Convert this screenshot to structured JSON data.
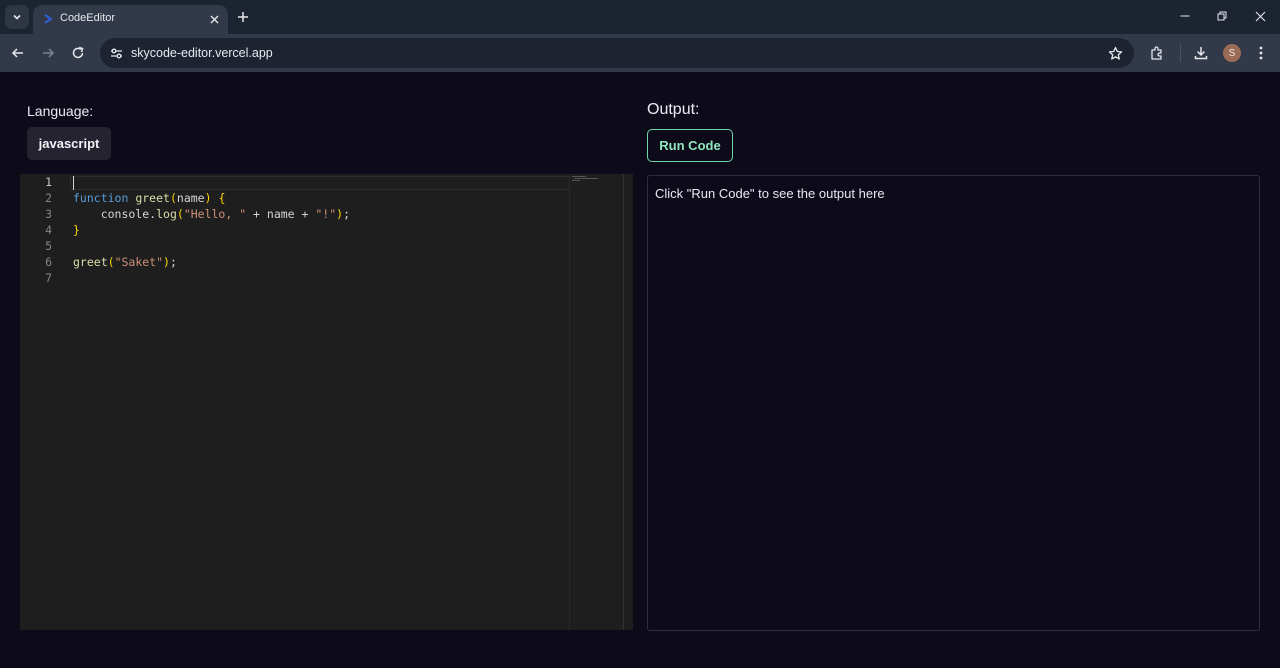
{
  "browser": {
    "tab_title": "CodeEditor",
    "url": "skycode-editor.vercel.app",
    "profile_initial": "S"
  },
  "editor_page": {
    "language_label": "Language:",
    "language_value": "javascript",
    "output_label": "Output:",
    "run_button_label": "Run Code",
    "output_placeholder": "Click \"Run Code\" to see the output here"
  },
  "code": {
    "line_numbers": [
      "1",
      "2",
      "3",
      "4",
      "5",
      "6",
      "7"
    ],
    "lines": [
      "",
      "function greet(name) {",
      "    console.log(\"Hello, \" + name + \"!\");",
      "}",
      "",
      "greet(\"Saket\");",
      ""
    ]
  },
  "colors": {
    "page_bg": "#0d0b1a",
    "editor_bg": "#1e1e1e",
    "run_button_accent": "#6fd6a8"
  }
}
